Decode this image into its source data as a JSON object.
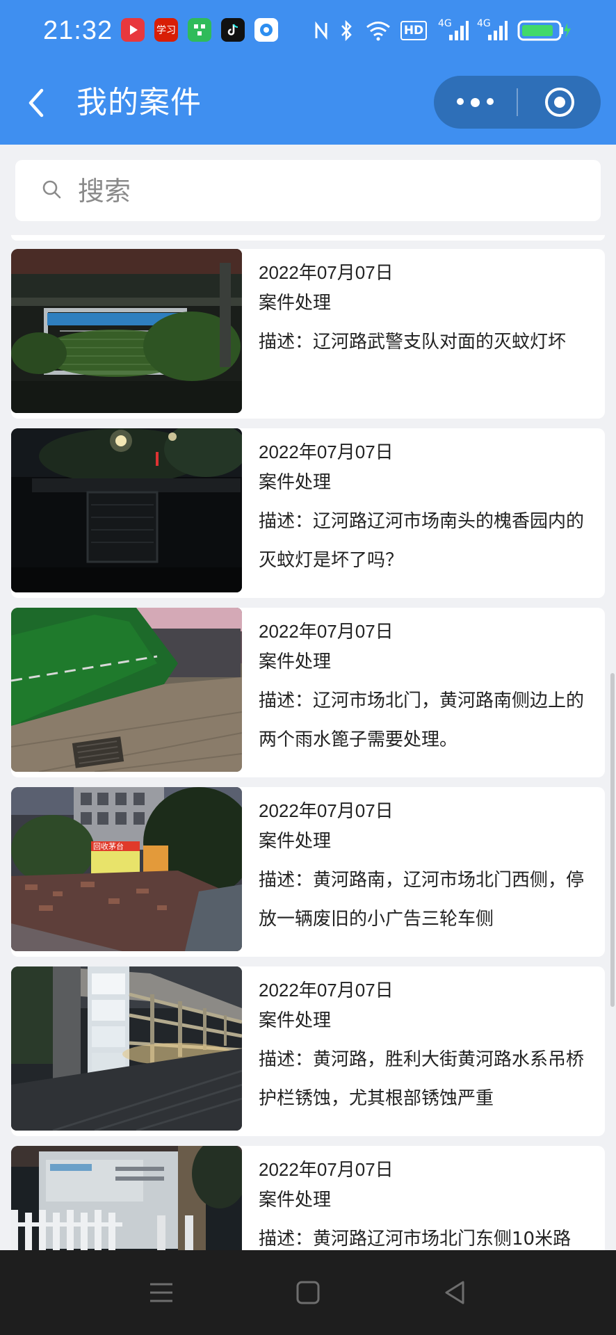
{
  "status_bar": {
    "time": "21:32",
    "app_icons": [
      {
        "name": "video-app-icon",
        "glyph": "▶",
        "color": "#e8383d"
      },
      {
        "name": "study-app-icon",
        "glyph": "学习",
        "color": "#d81e06"
      },
      {
        "name": "wechat-work-app-icon",
        "glyph": "☷",
        "color": "#2fbb5a"
      },
      {
        "name": "tiktok-app-icon",
        "glyph": "♪",
        "color": "#111111"
      },
      {
        "name": "record-app-icon",
        "glyph": "◉",
        "color": "#ffffff"
      }
    ],
    "network_labels": {
      "hd": "HD",
      "sim1": "4G",
      "sim2": "4G"
    }
  },
  "nav": {
    "title": "我的案件"
  },
  "search": {
    "placeholder": "搜索",
    "value": ""
  },
  "cases": [
    {
      "date": "2022年07月07日",
      "type": "案件处理",
      "description": "描述：辽河路武警支队对面的灭蚊灯坏"
    },
    {
      "date": "2022年07月07日",
      "type": "案件处理",
      "description": "描述：辽河路辽河市场南头的槐香园内的灭蚊灯是坏了吗？"
    },
    {
      "date": "2022年07月07日",
      "type": "案件处理",
      "description": "描述：辽河市场北门，黄河路南侧边上的两个雨水篦子需要处理。"
    },
    {
      "date": "2022年07月07日",
      "type": "案件处理",
      "description": "描述：黄河路南，辽河市场北门西侧，停放一辆废旧的小广告三轮车侧"
    },
    {
      "date": "2022年07月07日",
      "type": "案件处理",
      "description": "描述：黄河路，胜利大街黄河路水系吊桥护栏锈蚀，尤其根部锈蚀严重"
    },
    {
      "date": "2022年07月07日",
      "type": "案件处理",
      "description": "描述：黄河路辽河市场北门东侧10米路"
    }
  ],
  "photo_texts": {
    "sign_recycle": "回收茅台"
  },
  "colors": {
    "header_bg": "#3f8ff0",
    "capsule_bg": "#2e6fb8",
    "page_bg": "#f0f1f4",
    "card_bg": "#ffffff",
    "system_nav_bg": "#1e1e1e"
  }
}
